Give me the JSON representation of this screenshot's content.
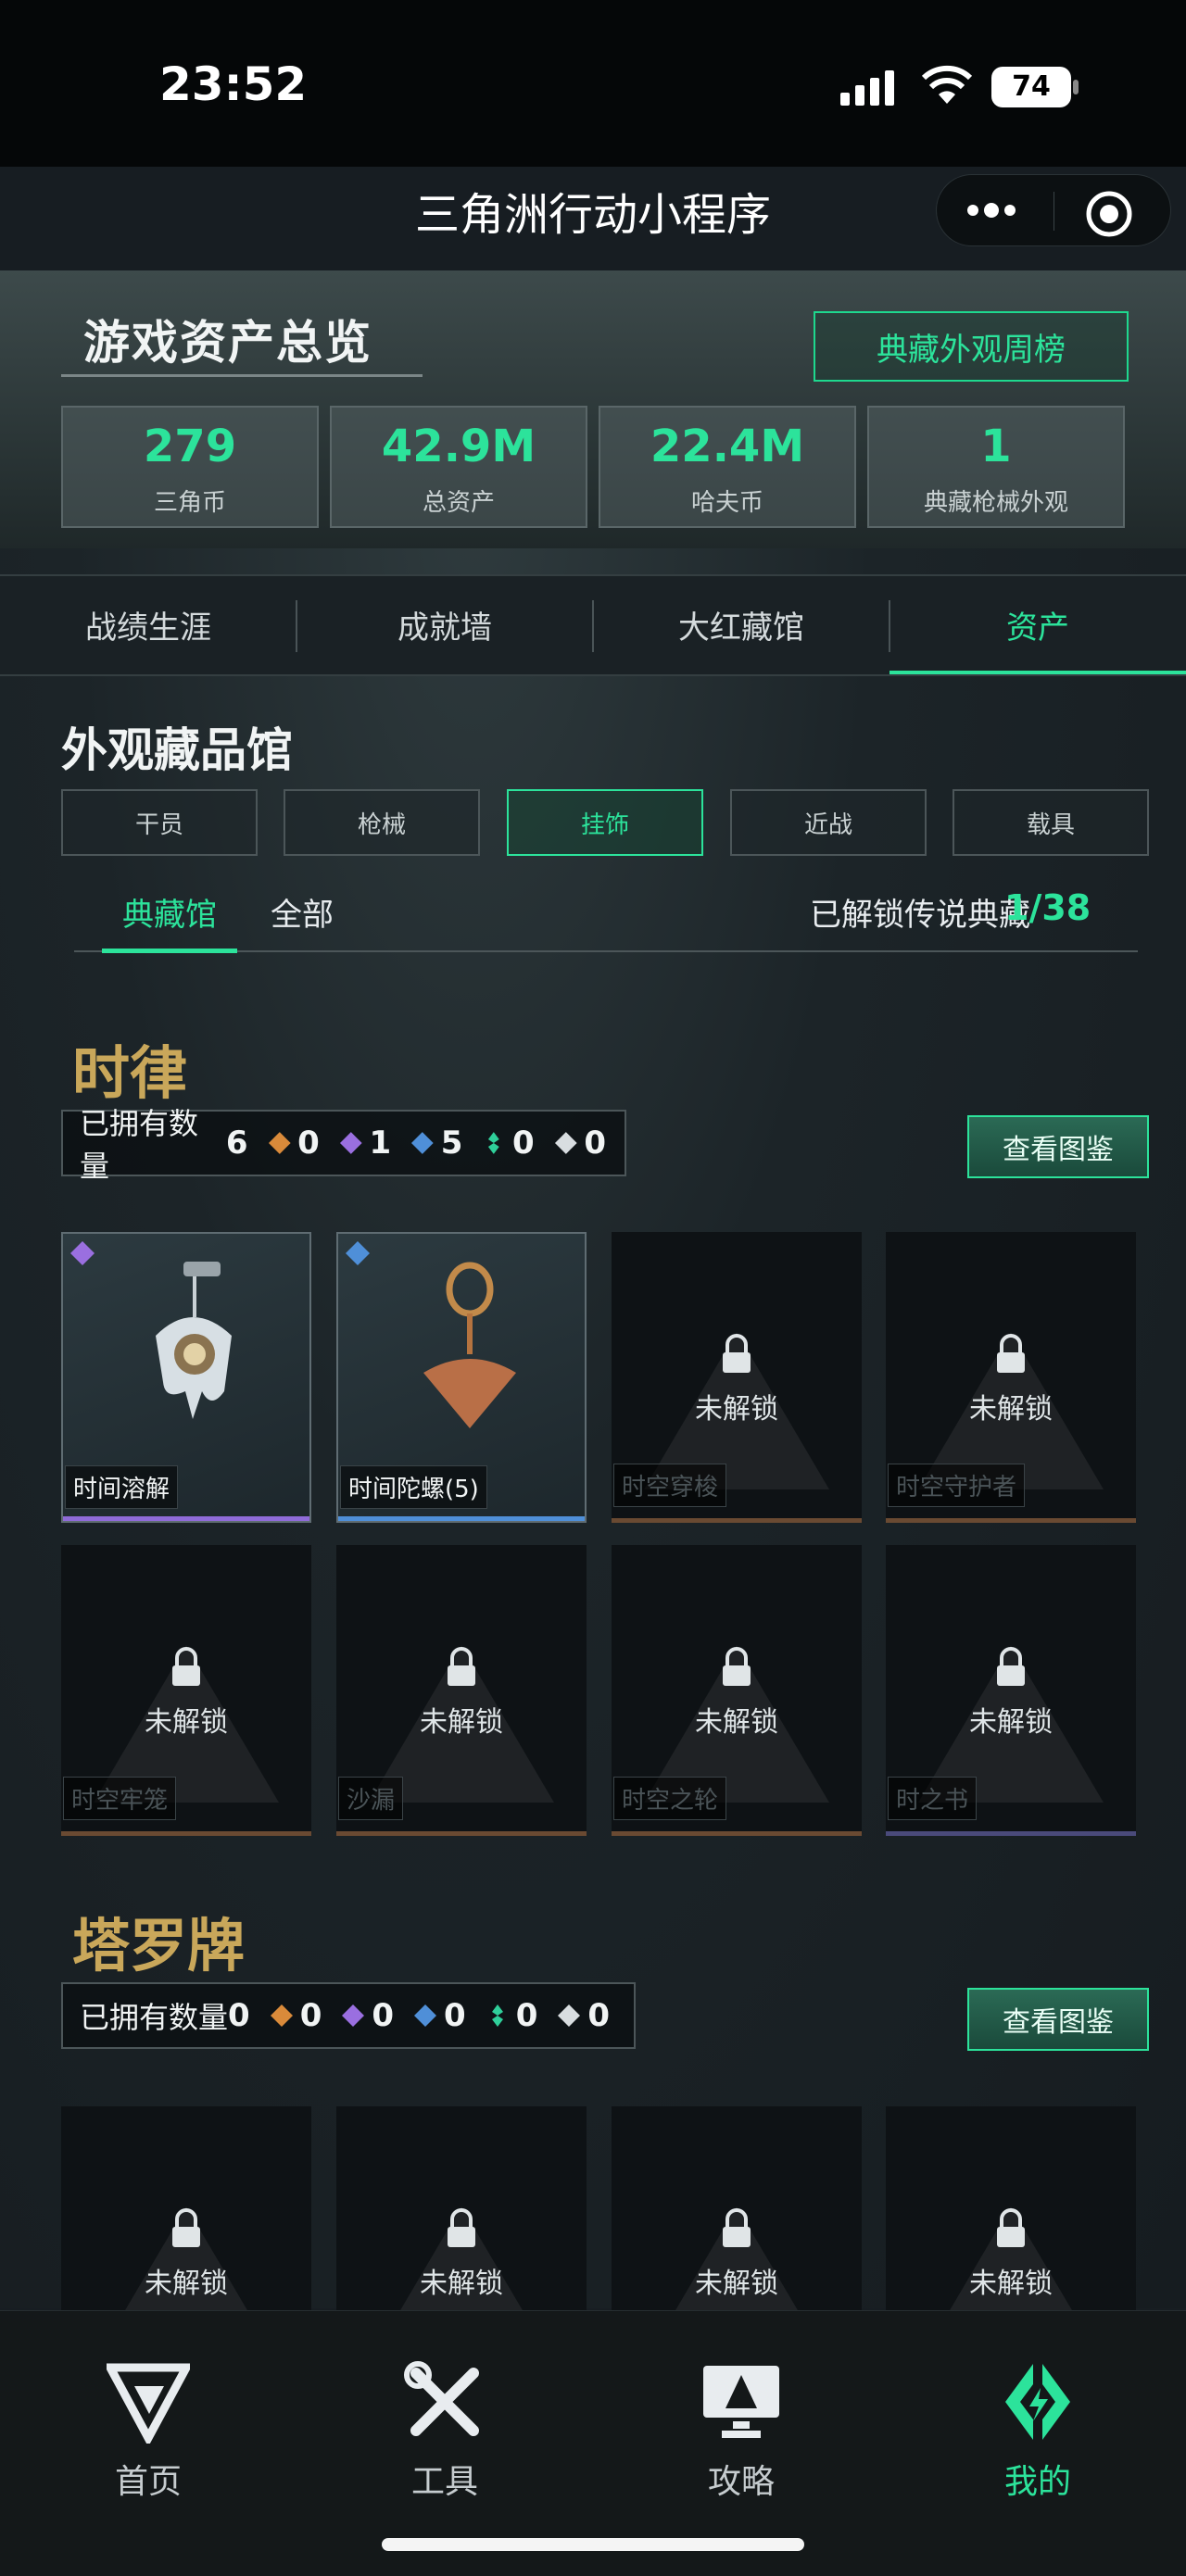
{
  "status": {
    "time": "23:52",
    "battery": "74"
  },
  "nav": {
    "title": "三角洲行动小程序"
  },
  "hero": {
    "title": "游戏资产总览",
    "rank_button": "典藏外观周榜",
    "stats": [
      {
        "value": "279",
        "label": "三角币"
      },
      {
        "value": "42.9M",
        "label": "总资产"
      },
      {
        "value": "22.4M",
        "label": "哈夫币"
      },
      {
        "value": "1",
        "label": "典藏枪械外观"
      }
    ]
  },
  "tabs": [
    "战绩生涯",
    "成就墙",
    "大红藏馆",
    "资产"
  ],
  "section": {
    "title": "外观藏品馆",
    "categories": [
      "干员",
      "枪械",
      "挂饰",
      "近战",
      "载具"
    ],
    "active_category": "挂饰",
    "subtabs": {
      "gallery": "典藏馆",
      "all": "全部"
    },
    "unlock_label": "已解锁传说典藏",
    "unlock_count": "1/38"
  },
  "series1": {
    "logo": "时律",
    "owned_label": "已拥有数量",
    "owned": "6",
    "counts": [
      "0",
      "1",
      "5",
      "0",
      "0"
    ],
    "view_button": "查看图鉴",
    "items": [
      {
        "name": "时间溶解",
        "status": "owned",
        "rarity": "purple"
      },
      {
        "name": "时间陀螺(5)",
        "status": "owned",
        "rarity": "blue"
      },
      {
        "name": "时空穿梭",
        "status": "未解锁"
      },
      {
        "name": "时空守护者",
        "status": "未解锁"
      },
      {
        "name": "时空牢笼",
        "status": "未解锁"
      },
      {
        "name": "沙漏",
        "status": "未解锁"
      },
      {
        "name": "时空之轮",
        "status": "未解锁"
      },
      {
        "name": "时之书",
        "status": "未解锁"
      }
    ]
  },
  "series2": {
    "logo": "塔罗牌",
    "owned_label": "已拥有数量",
    "owned": "0",
    "counts": [
      "0",
      "0",
      "0",
      "0",
      "0"
    ],
    "view_button": "查看图鉴",
    "items": [
      {
        "status": "未解锁"
      },
      {
        "status": "未解锁"
      },
      {
        "status": "未解锁"
      },
      {
        "status": "未解锁"
      }
    ]
  },
  "bottom_nav": [
    "首页",
    "工具",
    "攻略",
    "我的"
  ],
  "colors": {
    "accent": "#2ce39b",
    "gold": "#d98a3a",
    "purple": "#9a6fe0",
    "blue": "#4f8fd8",
    "teal": "#2fcf9a"
  }
}
